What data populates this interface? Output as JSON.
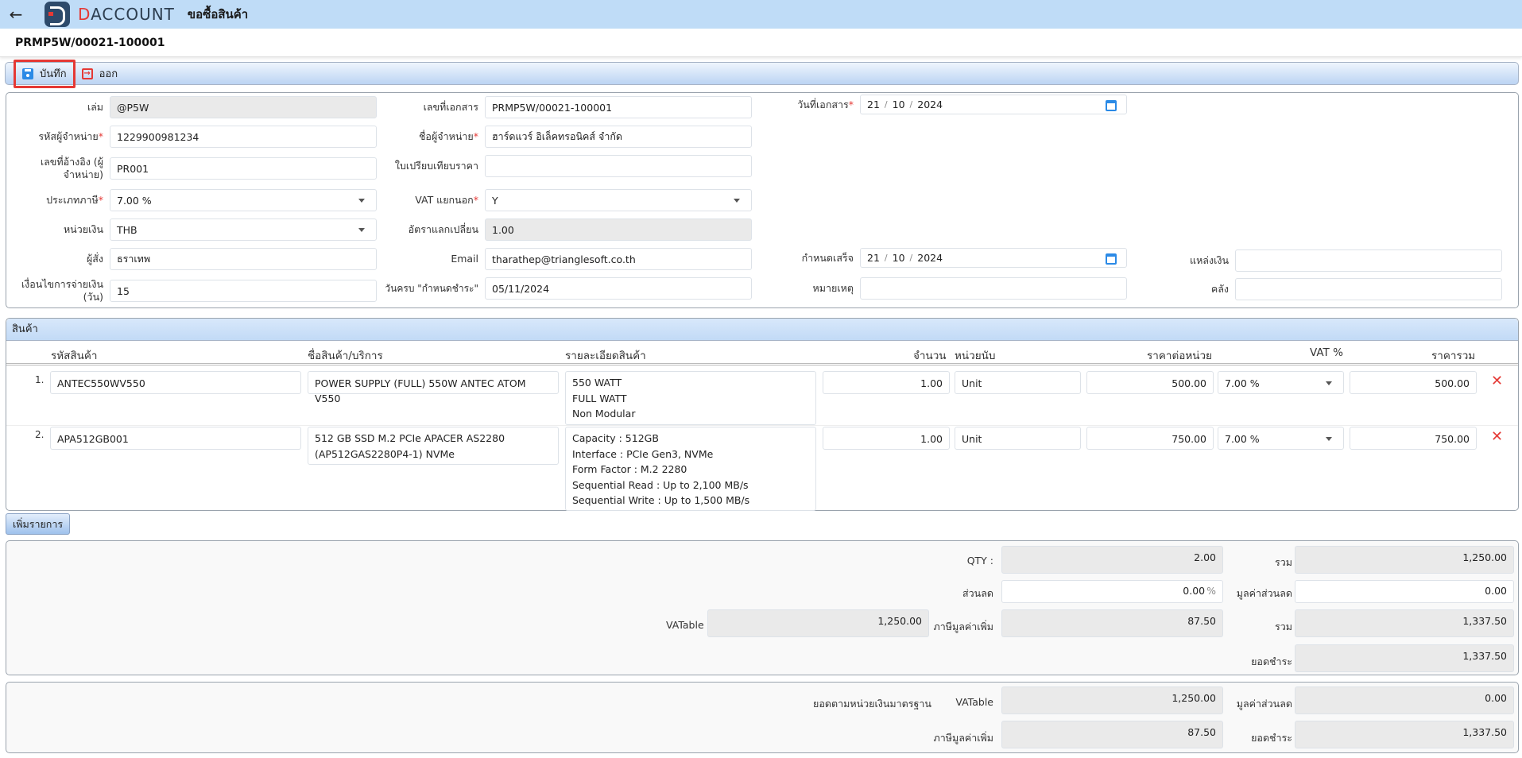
{
  "app": {
    "back_icon": "arrow-left-icon",
    "brand_d": "D",
    "brand_rest": "ACCOUNT",
    "page_title": "ขอซื้อสินค้า",
    "document_number": "PRMP5W/00021-100001"
  },
  "toolbar": {
    "save_label": "บันทึก",
    "save_icon": "save-icon",
    "exit_label": "ออก",
    "exit_icon": "exit-icon"
  },
  "form": {
    "book": {
      "label": "เล่ม",
      "value": "@P5W"
    },
    "doc_no": {
      "label": "เลขที่เอกสาร",
      "value": "PRMP5W/00021-100001"
    },
    "doc_date": {
      "label": "วันที่เอกสาร",
      "required": "*",
      "day": "21",
      "month": "10",
      "year": "2024"
    },
    "vendor_code": {
      "label": "รหัสผู้จำหน่าย",
      "required": "*",
      "value": "1229900981234"
    },
    "vendor_name": {
      "label": "ชื่อผู้จำหน่าย",
      "required": "*",
      "value": "ฮาร์ดแวร์ อิเล็คทรอนิคส์ จำกัด"
    },
    "vendor_ref": {
      "label_line1": "เลขที่อ้างอิง (ผู้",
      "label_line2": "จำหน่าย)",
      "value": "PR001"
    },
    "quotation": {
      "label": "ใบเปรียบเทียบราคา",
      "value": ""
    },
    "tax_type": {
      "label": "ประเภทภาษี",
      "required": "*",
      "value": "7.00 %"
    },
    "vat_separate": {
      "label": "VAT แยกนอก",
      "required": "*",
      "value": "Y"
    },
    "currency": {
      "label": "หน่วยเงิน",
      "value": "THB"
    },
    "exchange_rate": {
      "label": "อัตราแลกเปลี่ยน",
      "value": "1.00"
    },
    "orderer": {
      "label": "ผู้สั่ง",
      "value": "ธราเทพ"
    },
    "email": {
      "label": "Email",
      "value": "tharathep@trianglesoft.co.th"
    },
    "due_date": {
      "label": "กำหนดเสร็จ",
      "day": "21",
      "month": "10",
      "year": "2024"
    },
    "fund_source": {
      "label": "แหล่งเงิน",
      "value": ""
    },
    "payment_terms": {
      "label_line1": "เงื่อนไขการจ่ายเงิน",
      "label_line2": "(วัน)",
      "value": "15"
    },
    "payment_due": {
      "label": "วันครบ \"กำหนดชำระ\"",
      "value": "05/11/2024"
    },
    "remark": {
      "label": "หมายเหตุ",
      "value": ""
    },
    "warehouse": {
      "label": "คลัง",
      "value": ""
    }
  },
  "items": {
    "section_title": "สินค้า",
    "columns": {
      "code": "รหัสสินค้า",
      "name": "ชื่อสินค้า/บริการ",
      "detail": "รายละเอียดสินค้า",
      "qty": "จำนวน",
      "unit": "หน่วยนับ",
      "unit_price": "ราคาต่อหน่วย",
      "vat": "VAT %",
      "total": "ราคารวม"
    },
    "rows": [
      {
        "num": "1.",
        "code": "ANTEC550WV550",
        "name_line1": "POWER SUPPLY (FULL) 550W ANTEC ATOM V550",
        "name_line2": "",
        "detail": [
          "550 WATT",
          "FULL WATT",
          "Non Modular"
        ],
        "qty": "1.00",
        "unit": "Unit",
        "unit_price": "500.00",
        "vat": "7.00 %",
        "total": "500.00"
      },
      {
        "num": "2.",
        "code": "APA512GB001",
        "name_line1": "512 GB SSD M.2 PCIe APACER AS2280",
        "name_line2": "(AP512GAS2280P4-1) NVMe",
        "detail": [
          "Capacity : 512GB",
          "Interface : PCIe Gen3, NVMe",
          "Form Factor : M.2 2280",
          "Sequential Read : Up to 2,100 MB/s",
          "Sequential Write : Up to 1,500 MB/s"
        ],
        "qty": "1.00",
        "unit": "Unit",
        "unit_price": "750.00",
        "vat": "7.00 %",
        "total": "750.00"
      }
    ],
    "delete_icon": "close-x-icon",
    "add_label": "เพิ่มรายการ"
  },
  "summary": {
    "qty_label": "QTY :",
    "qty_value": "2.00",
    "sum_label": "รวม",
    "sum_value": "1,250.00",
    "discount_label": "ส่วนลด",
    "discount_value": "0.00",
    "discount_unit": "%",
    "discount_amount_label": "มูลค่าส่วนลด",
    "discount_amount_value": "0.00",
    "vatable_label": "VATable",
    "vatable_value": "1,250.00",
    "vat_label": "ภาษีมูลค่าเพิ่ม",
    "vat_value": "87.50",
    "total_label": "รวม",
    "total_value": "1,337.50",
    "net_label": "ยอดชำระ",
    "net_value": "1,337.50"
  },
  "standard_currency": {
    "title": "ยอดตามหน่วยเงินมาตรฐาน",
    "vatable_label": "VATable",
    "vatable_value": "1,250.00",
    "discount_amount_label": "มูลค่าส่วนลด",
    "discount_amount_value": "0.00",
    "vat_label": "ภาษีมูลค่าเพิ่ม",
    "vat_value": "87.50",
    "net_label": "ยอดชำระ",
    "net_value": "1,337.50"
  }
}
